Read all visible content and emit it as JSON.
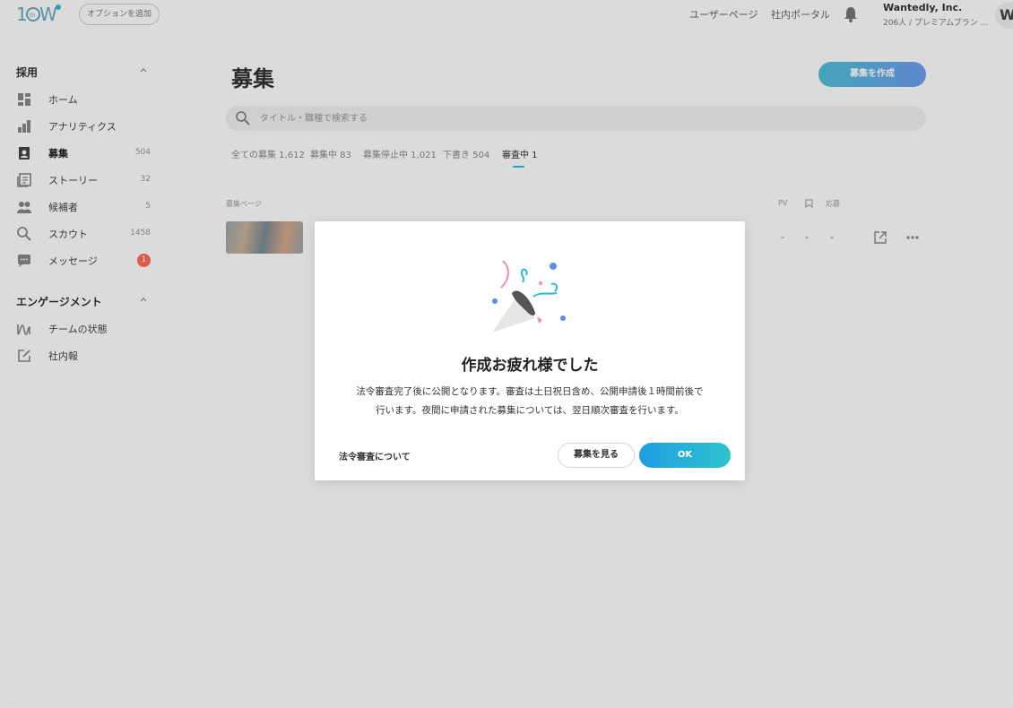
{
  "header": {
    "logo": "10w",
    "option_button": "オプションを追加",
    "links": [
      "ユーザーページ",
      "社内ポータル"
    ],
    "company_name": "Wantedly, Inc.",
    "company_sub": "206人 / プレミアムプラン ...",
    "avatar_letter": "W"
  },
  "sidebar": {
    "sections": [
      {
        "title": "採用",
        "items": [
          {
            "label": "ホーム",
            "icon": "dashboard-icon",
            "count": ""
          },
          {
            "label": "アナリティクス",
            "icon": "bar-chart-icon",
            "count": ""
          },
          {
            "label": "募集",
            "icon": "recruit-icon",
            "count": "504",
            "active": true
          },
          {
            "label": "ストーリー",
            "icon": "story-icon",
            "count": "32"
          },
          {
            "label": "候補者",
            "icon": "people-icon",
            "count": "5"
          },
          {
            "label": "スカウト",
            "icon": "search-icon",
            "count": "1458"
          },
          {
            "label": "メッセージ",
            "icon": "message-icon",
            "badge": "1"
          }
        ]
      },
      {
        "title": "エンゲージメント",
        "items": [
          {
            "label": "チームの状態",
            "icon": "wave-icon"
          },
          {
            "label": "社内報",
            "icon": "edit-icon"
          }
        ]
      }
    ]
  },
  "main": {
    "title": "募集",
    "create_button": "募集を作成",
    "search_placeholder": "タイトル・職種で検索する",
    "tabs": [
      "全ての募集 1,612",
      "募集中 83",
      "募集停止中 1,021",
      "下書き 504",
      "審査中 1"
    ],
    "active_tab": 4,
    "columns": {
      "page": "募集ページ",
      "pv": "PV",
      "apply": "応募"
    },
    "row": {
      "pv": "-",
      "bookmark": "-",
      "apply": "-"
    }
  },
  "modal": {
    "title": "作成お疲れ様でした",
    "body_line1": "法令審査完了後に公開となります。審査は土日祝日含め、公開申請後１時間前後で",
    "body_line2": "行います。夜間に申請された募集については、翌日順次審査を行います。",
    "link": "法令審査について",
    "view_button": "募集を見る",
    "ok_button": "OK"
  },
  "colors": {
    "accent": "#2bbbd8",
    "badge": "#ff6b57",
    "ok_gradient_start": "#1f9de0",
    "ok_gradient_end": "#2fc3cf"
  }
}
